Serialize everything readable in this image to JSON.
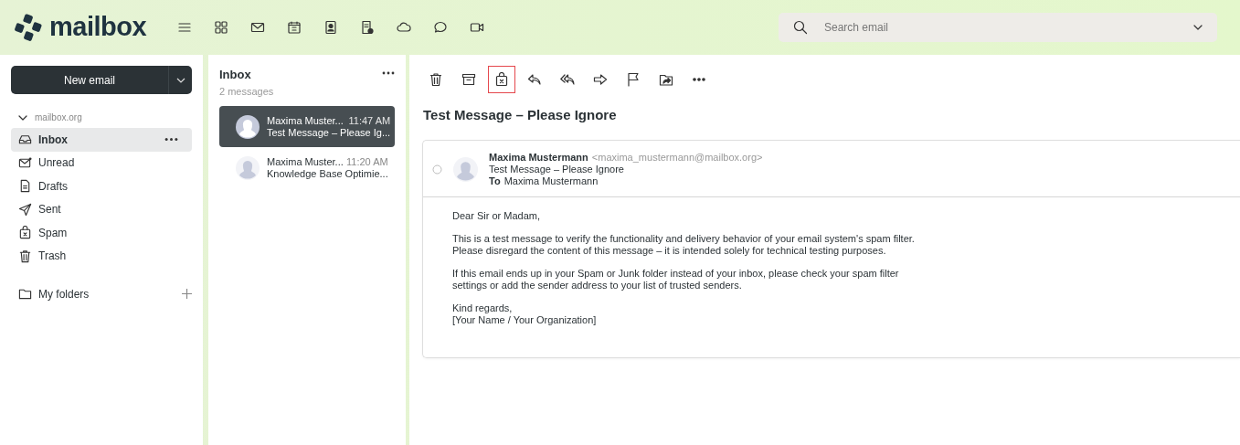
{
  "header": {
    "logo_text": "mailbox",
    "apps": [
      {
        "kind": "menu"
      },
      {
        "kind": "apps"
      },
      {
        "kind": "mail"
      },
      {
        "kind": "calendar"
      },
      {
        "kind": "contacts"
      },
      {
        "kind": "tasks"
      },
      {
        "kind": "cloud"
      },
      {
        "kind": "chat"
      },
      {
        "kind": "video"
      }
    ],
    "search": {
      "placeholder": "Search email"
    }
  },
  "sidebar": {
    "new_email": "New email",
    "account": {
      "name": "mailbox.org",
      "expanded": true
    },
    "folders": [
      {
        "kind": "inbox",
        "label": "Inbox",
        "selected": true
      },
      {
        "kind": "unread",
        "label": "Unread",
        "selected": false
      },
      {
        "kind": "drafts",
        "label": "Drafts",
        "selected": false
      },
      {
        "kind": "sent",
        "label": "Sent",
        "selected": false
      },
      {
        "kind": "spam",
        "label": "Spam",
        "selected": false
      },
      {
        "kind": "trash",
        "label": "Trash",
        "selected": false
      }
    ],
    "my_folders": "My folders"
  },
  "message_list": {
    "title": "Inbox",
    "count": "2 messages",
    "messages": [
      {
        "sender": "Maxima Muster...",
        "time": "11:47 AM",
        "subject": "Test Message – Please Ig...",
        "selected": true
      },
      {
        "sender": "Maxima Muster...",
        "time": "11:20 AM",
        "subject": "Knowledge Base Optimie...",
        "selected": false
      }
    ]
  },
  "toolbar": [
    {
      "kind": "delete",
      "highlighted": false
    },
    {
      "kind": "archive",
      "highlighted": false
    },
    {
      "kind": "spam",
      "highlighted": true
    },
    {
      "kind": "reply",
      "highlighted": false
    },
    {
      "kind": "reply_all",
      "highlighted": false
    },
    {
      "kind": "forward",
      "highlighted": false
    },
    {
      "kind": "flag",
      "highlighted": false
    },
    {
      "kind": "move",
      "highlighted": false
    },
    {
      "kind": "more",
      "highlighted": false
    }
  ],
  "reader": {
    "checked": false,
    "subject": "Test Message – Please Ignore",
    "from_name": "Maxima Mustermann",
    "from_address": "<maxima_mustermann@mailbox.org>",
    "header_subject": "Test Message – Please Ignore",
    "to_label": "To",
    "to": "Maxima Mustermann",
    "body": [
      [
        "Dear Sir or Madam,"
      ],
      [
        "This is a test message to verify the functionality and delivery behavior of your email system's spam filter.",
        "Please disregard the content of this message – it is intended solely for technical testing purposes."
      ],
      [
        "If this email ends up in your Spam or Junk folder instead of your inbox, please check your spam filter",
        "settings or add the sender address to your list of trusted senders."
      ],
      [
        "Kind regards,",
        "[Your Name / Your Organization]"
      ]
    ]
  }
}
